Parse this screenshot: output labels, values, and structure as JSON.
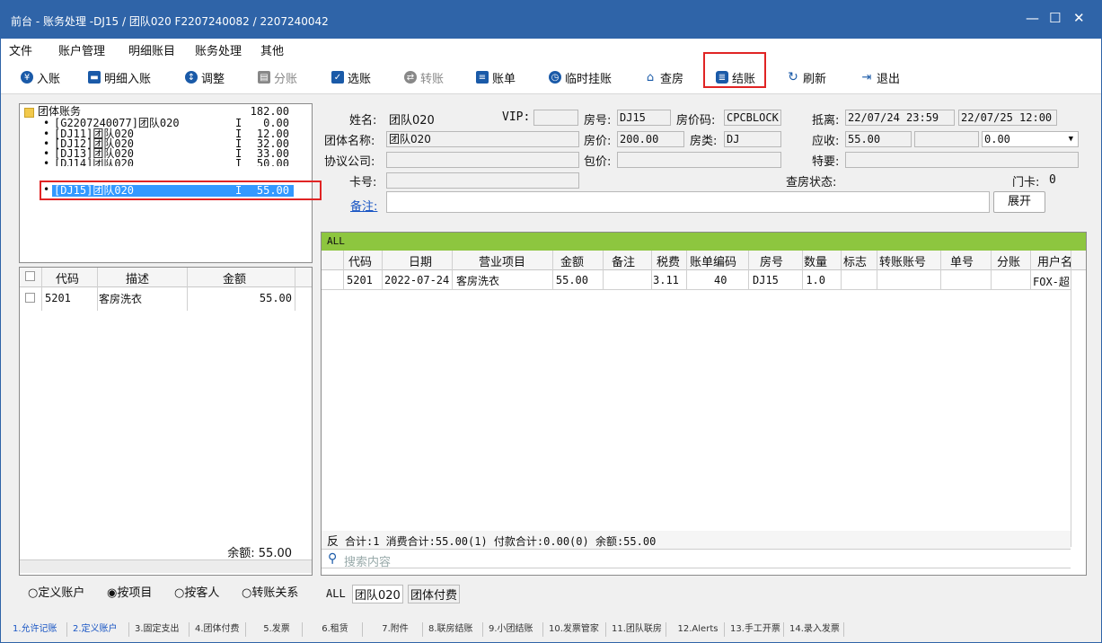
{
  "window": {
    "title": "前台 - 账务处理 -DJ15 / 团队020 F2207240082 / 2207240042",
    "min": "—",
    "max": "☐",
    "close": "✕"
  },
  "menu": [
    "文件",
    "账户管理",
    "明细账目",
    "账务处理",
    "其他"
  ],
  "toolbar": [
    {
      "label": "入账",
      "icon": "yen-icon",
      "enabled": true
    },
    {
      "label": "明细入账",
      "icon": "ledger-icon",
      "enabled": true
    },
    {
      "label": "调整",
      "icon": "adjust-icon",
      "enabled": true
    },
    {
      "label": "分账",
      "icon": "split-icon",
      "enabled": false
    },
    {
      "label": "选账",
      "icon": "select-icon",
      "enabled": true
    },
    {
      "label": "转账",
      "icon": "transfer-icon",
      "enabled": false
    },
    {
      "label": "账单",
      "icon": "bill-icon",
      "enabled": true
    },
    {
      "label": "临时挂账",
      "icon": "clock-icon",
      "enabled": true
    },
    {
      "label": "查房",
      "icon": "house-icon",
      "enabled": true
    },
    {
      "label": "结账",
      "icon": "database-icon",
      "enabled": true,
      "highlighted": true
    },
    {
      "label": "刷新",
      "icon": "refresh-icon",
      "enabled": true
    },
    {
      "label": "退出",
      "icon": "exit-icon",
      "enabled": true
    }
  ],
  "tree": {
    "root": {
      "label": "团体账务",
      "amount": "182.00"
    },
    "items": [
      {
        "label": "[G2207240077]团队020",
        "flag": "I",
        "amount": "0.00"
      },
      {
        "label": "[DJ11]团队020",
        "flag": "I",
        "amount": "12.00"
      },
      {
        "label": "[DJ12]团队020",
        "flag": "I",
        "amount": "32.00"
      },
      {
        "label": "[DJ13]团队020",
        "flag": "I",
        "amount": "33.00"
      },
      {
        "label": "[DJ14]团队020",
        "flag": "I",
        "amount": "50.00"
      },
      {
        "label": "[DJ15]团队020",
        "flag": "I",
        "amount": "55.00",
        "selected": true
      }
    ]
  },
  "left_grid": {
    "headers": [
      "代码",
      "描述",
      "金额"
    ],
    "rows": [
      {
        "code": "5201",
        "desc": "客房洗衣",
        "amount": "55.00"
      }
    ],
    "balance": "余额: 55.00"
  },
  "radios": [
    {
      "label": "定义账户",
      "checked": false
    },
    {
      "label": "按项目",
      "checked": true
    },
    {
      "label": "按客人",
      "checked": false
    },
    {
      "label": "转账关系",
      "checked": false
    }
  ],
  "info": {
    "name_label": "姓名:",
    "name": "团队020",
    "vip_label": "VIP:",
    "vip": "",
    "room_label": "房号:",
    "room": "DJ15",
    "rate_code_label": "房价码:",
    "rate_code": "CPCBLOCK",
    "arr_label": "抵离:",
    "arrival": "22/07/24 23:59",
    "departure": "22/07/25 12:00",
    "group_label": "团体名称:",
    "group": "团队020",
    "rate_label": "房价:",
    "rate": "200.00",
    "roomtype_label": "房类:",
    "roomtype": "DJ",
    "receivable_label": "应收:",
    "receivable": "55.00",
    "receivable2": "",
    "dropdown_value": "0.00",
    "company_label": "协议公司:",
    "company": "",
    "package_label": "包价:",
    "package": "",
    "special_label": "特要:",
    "special": "",
    "card_label": "卡号:",
    "card": "",
    "checkroom_label": "查房状态:",
    "checkroom": "",
    "doorcard_label": "门卡:",
    "doorcard": "0",
    "remark_label": "备注:",
    "remark": "",
    "expand": "展开"
  },
  "main_grid": {
    "band": "ALL",
    "headers": [
      "代码",
      "日期",
      "营业项目",
      "金额",
      "备注",
      "税费",
      "账单编码",
      "房号",
      "数量",
      "标志",
      "转账账号",
      "单号",
      "分账",
      "用户名"
    ],
    "rows": [
      {
        "code": "5201",
        "date": "2022-07-24",
        "item": "客房洗衣",
        "amount": "55.00",
        "remark": "",
        "tax": "3.11",
        "bill": "40",
        "room": "DJ15",
        "qty": "1.0",
        "flag": "",
        "transfer": "",
        "no": "",
        "split": "",
        "user": "FOX-超"
      }
    ],
    "footer_toggle": "反",
    "summary": "合计:1  消费合计:55.00(1)  付款合计:0.00(0)  余额:55.00",
    "search_placeholder": "搜索内容"
  },
  "bottom_tabs": [
    "ALL",
    "团队020",
    "团体付费"
  ],
  "status_tabs": [
    "1.允许记账",
    "2.定义账户",
    "3.固定支出",
    "4.团体付费",
    "5.发票",
    "6.租赁",
    "7.附件",
    "8.联房结账",
    "9.小团结账",
    "10.发票管家",
    "11.团队联房",
    "12.Alerts",
    "13.手工开票",
    "14.录入发票"
  ],
  "colors": {
    "title_bg": "#2f64a8",
    "band_green": "#8dc63f",
    "highlight": "#e02424",
    "selection": "#3399ff",
    "link": "#1a56c4"
  }
}
